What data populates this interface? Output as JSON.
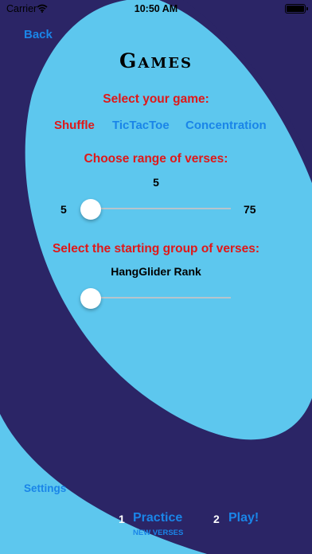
{
  "status_bar": {
    "carrier": "Carrier",
    "time": "10:50 AM"
  },
  "nav": {
    "back_label": "Back"
  },
  "page": {
    "title": "Games"
  },
  "game_select": {
    "prompt": "Select your game:",
    "options": [
      {
        "label": "Shuffle",
        "selected": true
      },
      {
        "label": "TicTacToe",
        "selected": false
      },
      {
        "label": "Concentration",
        "selected": false
      }
    ]
  },
  "range": {
    "prompt": "Choose range of verses:",
    "current_value": "5",
    "min_label": "5",
    "max_label": "75",
    "fill_fraction": 0.0
  },
  "group": {
    "prompt": "Select the starting group of verses:",
    "current_group": "HangGlider Rank",
    "fill_fraction": 0.0
  },
  "footer": {
    "settings_label": "Settings",
    "practice_num": "1",
    "practice_label": "Practice",
    "practice_sub": "NEW VERSES",
    "play_num": "2",
    "play_label": "Play!"
  },
  "colors": {
    "background": "#5dc7ee",
    "swirl": "#2b2566",
    "accent_blue": "#1a85e8",
    "prompt_red": "#e01818"
  }
}
